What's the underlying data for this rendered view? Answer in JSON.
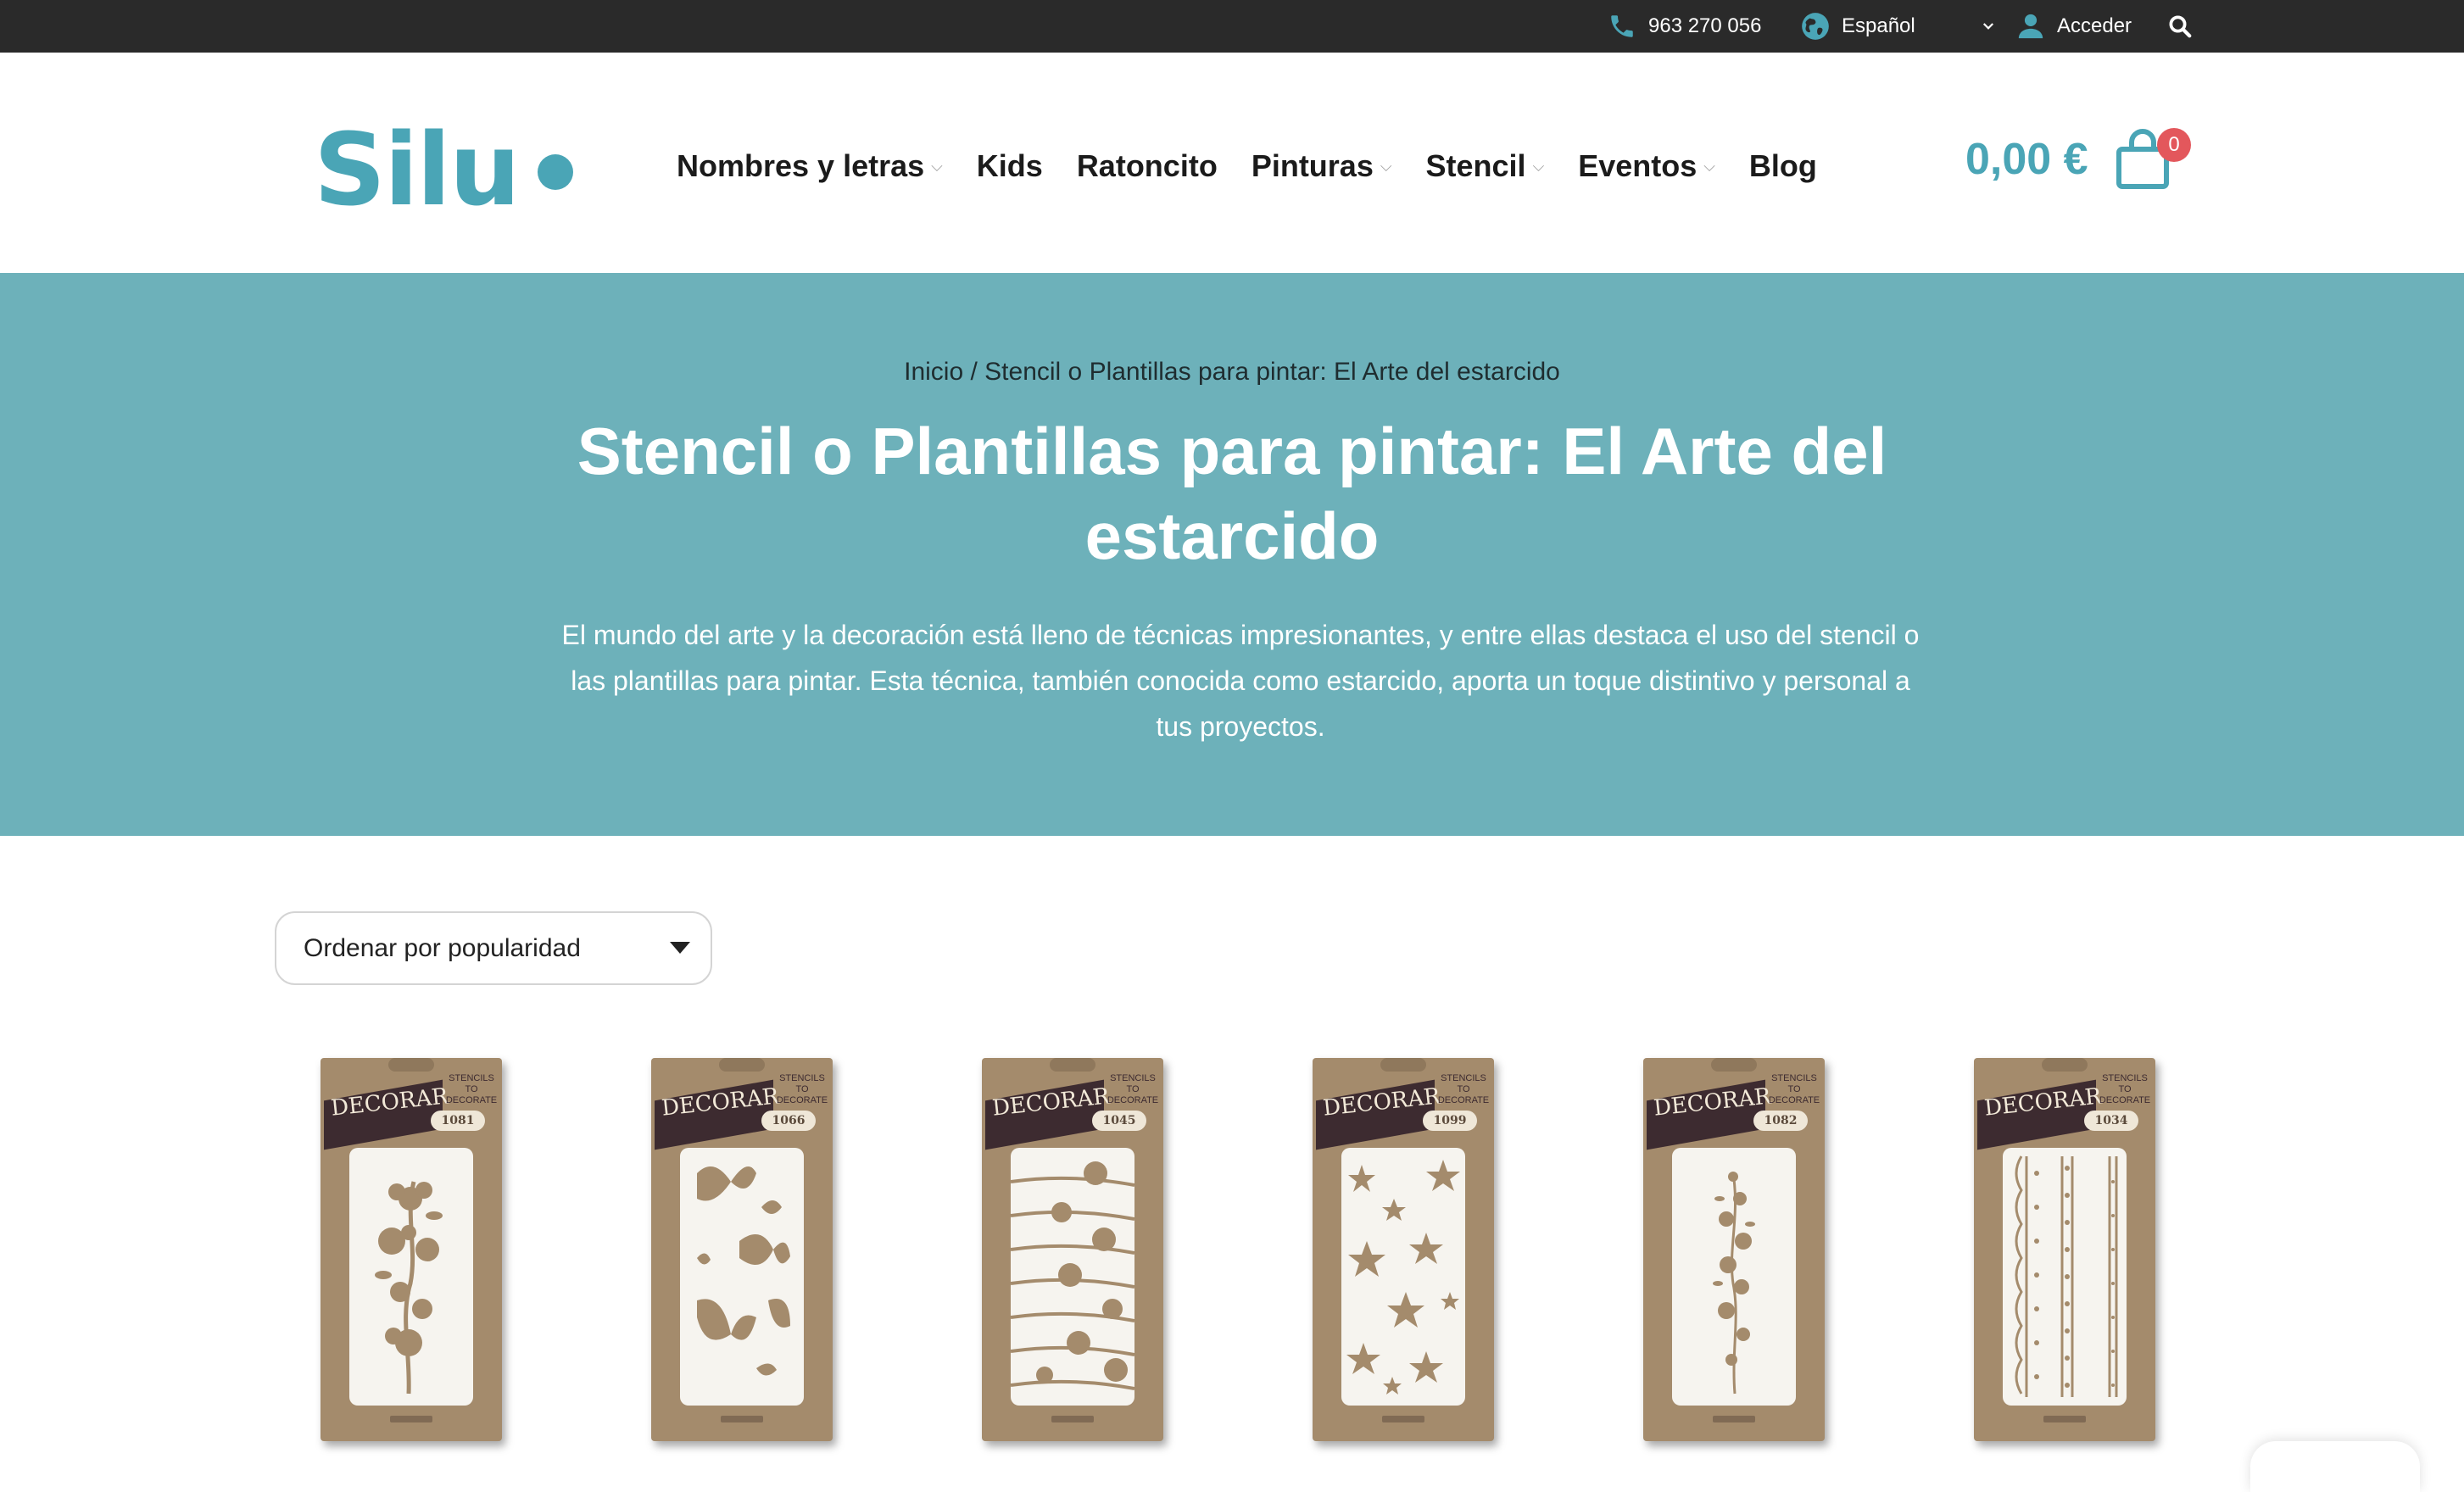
{
  "topbar": {
    "phone": "963 270 056",
    "language": "Español",
    "login": "Acceder"
  },
  "header": {
    "logo": "Silu",
    "nav": [
      {
        "label": "Nombres y letras",
        "has_dropdown": true
      },
      {
        "label": "Kids",
        "has_dropdown": false
      },
      {
        "label": "Ratoncito",
        "has_dropdown": false
      },
      {
        "label": "Pinturas",
        "has_dropdown": true
      },
      {
        "label": "Stencil",
        "has_dropdown": true
      },
      {
        "label": "Eventos",
        "has_dropdown": true
      },
      {
        "label": "Blog",
        "has_dropdown": false
      }
    ],
    "cart_total": "0,00 €",
    "cart_count": "0"
  },
  "hero": {
    "breadcrumb": "Inicio / Stencil o Plantillas para pintar: El Arte del estarcido",
    "title": "Stencil o Plantillas para pintar: El Arte del estarcido",
    "description": "El mundo del arte y la decoración está lleno de técnicas impresionantes, y entre ellas destaca el uso del stencil o las plantillas para pintar. Esta técnica, también conocida como estarcido, aporta un toque distintivo y personal a tus proyectos."
  },
  "sort": {
    "selected": "Ordenar por popularidad"
  },
  "products": [
    {
      "banner": "DECORAR",
      "brand": "STENCILS TO DECORATE",
      "code": "1081",
      "pattern": "flower-vine"
    },
    {
      "banner": "DECORAR",
      "brand": "STENCILS TO DECORATE",
      "code": "1066",
      "pattern": "butterflies"
    },
    {
      "banner": "DECORAR",
      "brand": "STENCILS TO DECORATE",
      "code": "1045",
      "pattern": "flower-stripes"
    },
    {
      "banner": "DECORAR",
      "brand": "STENCILS TO DECORATE",
      "code": "1099",
      "pattern": "stars"
    },
    {
      "banner": "DECORAR",
      "brand": "STENCILS TO DECORATE",
      "code": "1082",
      "pattern": "blossom-branch"
    },
    {
      "banner": "DECORAR",
      "brand": "STENCILS TO DECORATE",
      "code": "1034",
      "pattern": "lace-borders"
    }
  ],
  "colors": {
    "topbar": "#2a2a2a",
    "brand": "#4aa5b6",
    "hero": "#6db1ba",
    "badge": "#e3575c",
    "kraft": "#a48b6c"
  }
}
